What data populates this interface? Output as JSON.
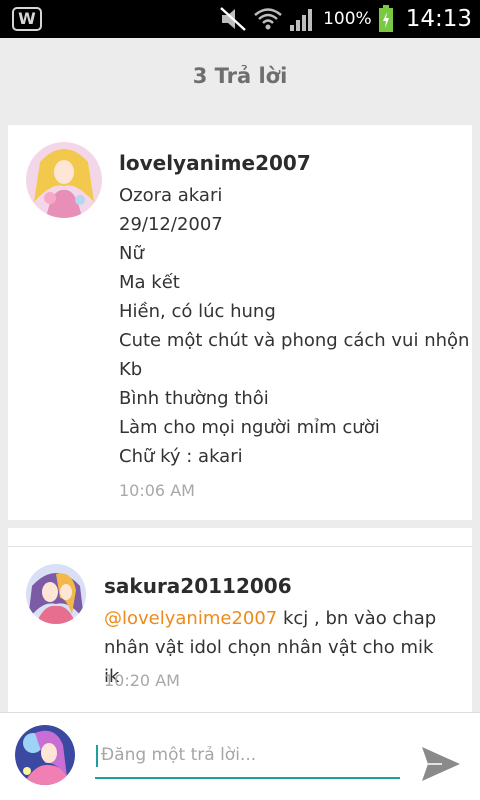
{
  "status_bar": {
    "battery_percent": "100%",
    "time": "14:13",
    "app_icon": "wattpad-icon",
    "icons": [
      "mute-icon",
      "wifi-icon",
      "signal-icon",
      "battery-icon"
    ]
  },
  "header": {
    "title": "3 Trả lời"
  },
  "comments": [
    {
      "username": "lovelyanime2007",
      "lines": [
        "Ozora akari",
        "29/12/2007",
        "Nữ",
        "Ma kết",
        "Hiền, có lúc hung",
        "Cute một chút và phong cách vui nhộn",
        "Kb",
        "Bình thường thôi",
        "Làm cho mọi người mỉm cười",
        "Chữ ký : akari"
      ],
      "time": "10:06 AM"
    },
    {
      "username": "sakura20112006",
      "mention": "@lovelyanime2007",
      "text": " kcj , bn vào chap nhân vật idol chọn nhân vật cho mik ik",
      "time": "10:20 AM"
    }
  ],
  "reply_input": {
    "placeholder": "Đăng một trả lời..."
  },
  "colors": {
    "mention": "#ef8a1a",
    "accent": "#1aa0a0",
    "background": "#ececec"
  }
}
